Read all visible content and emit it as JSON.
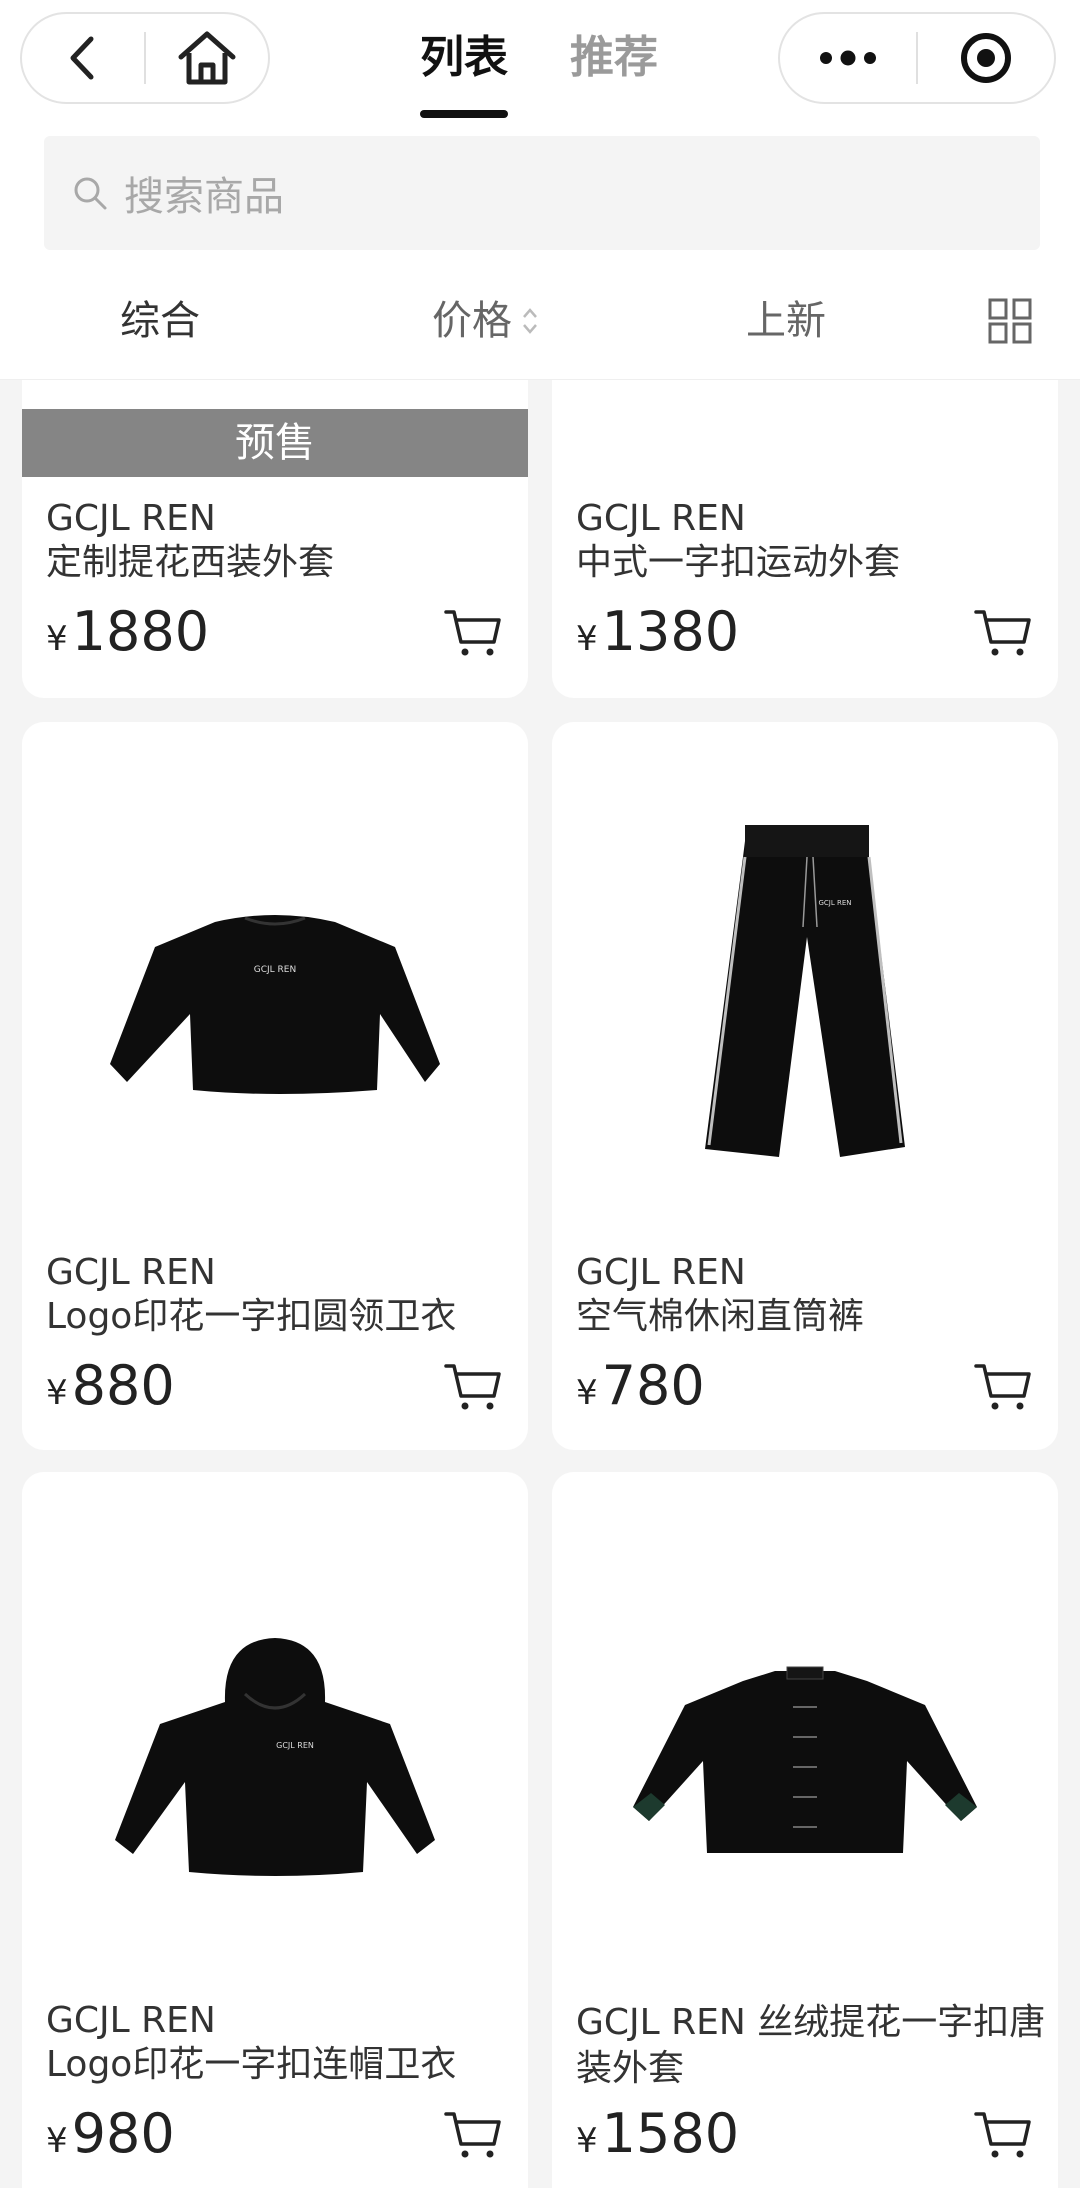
{
  "header": {
    "tabs": [
      {
        "label": "列表",
        "active": true
      },
      {
        "label": "推荐",
        "active": false
      }
    ]
  },
  "search": {
    "placeholder": "搜索商品"
  },
  "sortbar": {
    "items": [
      "综合",
      "价格",
      "上新"
    ]
  },
  "badges": {
    "presale": "预售"
  },
  "products": [
    {
      "brand": "GCJL REN",
      "name": "定制提花西装外套",
      "currency": "¥",
      "price": "1880",
      "image": "presale-item"
    },
    {
      "brand": "GCJL REN",
      "name": "中式一字扣运动外套",
      "currency": "¥",
      "price": "1380",
      "image": "jacket"
    },
    {
      "brand": "GCJL REN",
      "name": "Logo印花一字扣圆领卫衣",
      "currency": "¥",
      "price": "880",
      "image": "sweatshirt"
    },
    {
      "brand": "GCJL REN",
      "name": "空气棉休闲直筒裤",
      "currency": "¥",
      "price": "780",
      "image": "pants"
    },
    {
      "brand": "GCJL REN",
      "name": "Logo印花一字扣连帽卫衣",
      "currency": "¥",
      "price": "980",
      "image": "hoodie"
    },
    {
      "brand": "",
      "name": "GCJL REN 丝绒提花一字扣唐装外套",
      "currency": "¥",
      "price": "1580",
      "image": "tang-jacket"
    }
  ],
  "logo_text": "GCJL REN",
  "colors": {
    "accent": "#111111",
    "background": "#f4f4f4",
    "presale_badge": "#858585"
  }
}
